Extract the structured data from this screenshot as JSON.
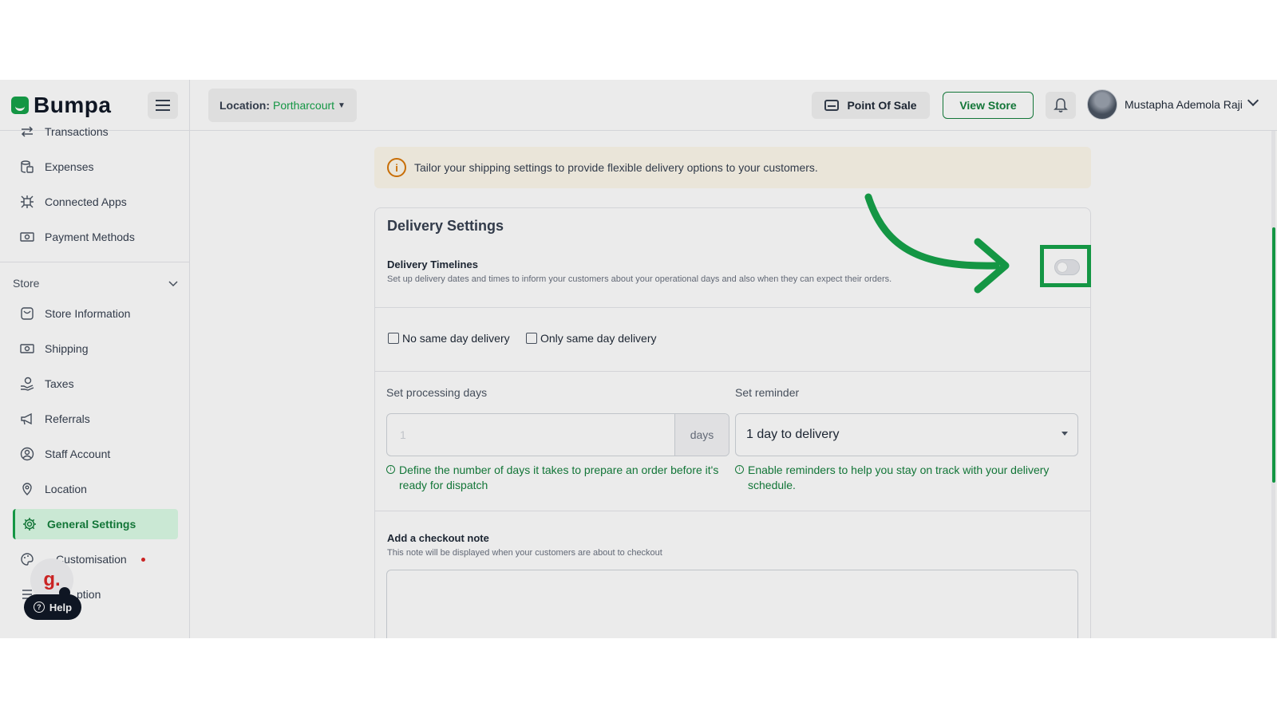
{
  "header": {
    "brand": "Bumpa",
    "location_label": "Location:",
    "location_value": "Portharcourt",
    "point_of_sale": "Point Of Sale",
    "view_store": "View Store",
    "user_name": "Mustapha Ademola Raji"
  },
  "sidebar": {
    "items_top": [
      {
        "label": "Transactions",
        "icon": "transactions-icon"
      },
      {
        "label": "Expenses",
        "icon": "expenses-icon"
      },
      {
        "label": "Connected Apps",
        "icon": "connected-apps-icon"
      },
      {
        "label": "Payment Methods",
        "icon": "payment-methods-icon"
      }
    ],
    "section_label": "Store",
    "items_store": [
      {
        "label": "Store Information",
        "icon": "store-information-icon"
      },
      {
        "label": "Shipping",
        "icon": "shipping-icon"
      },
      {
        "label": "Taxes",
        "icon": "taxes-icon"
      },
      {
        "label": "Referrals",
        "icon": "referrals-icon"
      },
      {
        "label": "Staff Account",
        "icon": "staff-account-icon"
      },
      {
        "label": "Location",
        "icon": "location-icon"
      },
      {
        "label": "General Settings",
        "icon": "gear-icon",
        "active": true
      },
      {
        "label": "Customisation",
        "icon": "palette-icon",
        "badge": "red-dot"
      },
      {
        "label": "ption",
        "icon": "subscription-icon"
      }
    ],
    "help": "Help",
    "badge_letter": "g."
  },
  "banner": {
    "text": "Tailor your shipping settings to provide flexible delivery options to your customers."
  },
  "delivery": {
    "title": "Delivery Settings",
    "timelines_title": "Delivery Timelines",
    "timelines_desc": "Set up delivery dates and times to inform your customers about your operational days and also when they can expect their orders.",
    "toggle_on": false,
    "no_same_day": "No same day delivery",
    "only_same_day": "Only same day delivery",
    "processing_label": "Set processing days",
    "processing_value": "1",
    "processing_unit": "days",
    "processing_hint": "Define the number of days it takes to prepare an order before it's ready for dispatch",
    "reminder_label": "Set reminder",
    "reminder_value": "1 day to delivery",
    "reminder_hint": "Enable reminders to help you stay on track with your delivery schedule.",
    "note_title": "Add a checkout note",
    "note_desc": "This note will be displayed when your customers are about to checkout"
  },
  "colors": {
    "accent": "#16a34a",
    "banner_bg": "#fef9ec",
    "highlight": "#16a34a"
  }
}
